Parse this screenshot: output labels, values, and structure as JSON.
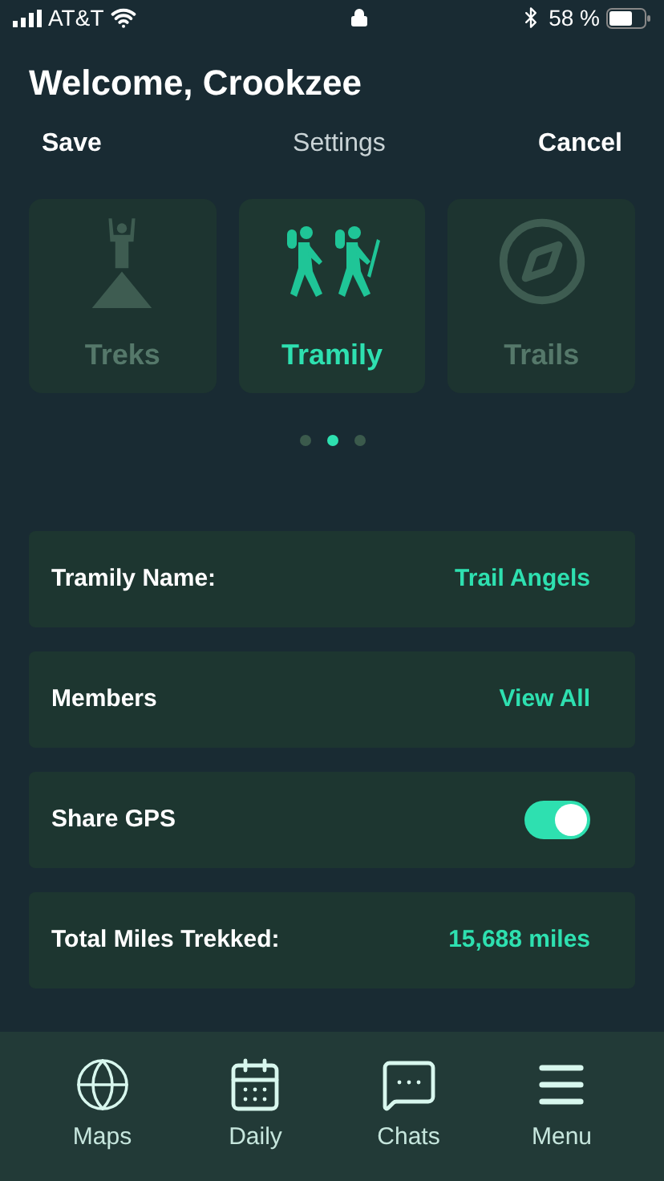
{
  "status_bar": {
    "carrier": "AT&T",
    "battery": "58 %"
  },
  "title": "Welcome, Crookzee",
  "nav": {
    "left": "Save",
    "center": "Settings",
    "right": "Cancel"
  },
  "carousel": [
    {
      "kind": "summit",
      "label": "Treks",
      "selected": false
    },
    {
      "kind": "hikers",
      "label": "Tramily",
      "selected": true
    },
    {
      "kind": "compass",
      "label": "Trails",
      "selected": false
    }
  ],
  "page_dots": [
    {
      "selected": false
    },
    {
      "selected": true
    },
    {
      "selected": false
    }
  ],
  "rows": [
    {
      "kind": "value",
      "label": "Tramily Name:",
      "value": "Trail Angels"
    },
    {
      "kind": "link",
      "label": "Members",
      "value": "View All"
    },
    {
      "kind": "toggle",
      "label": "Share GPS",
      "on": true
    },
    {
      "kind": "value",
      "label": "Total Miles Trekked:",
      "value": "15,688 miles"
    }
  ],
  "tab_bar": [
    {
      "kind": "maps",
      "label": "Maps"
    },
    {
      "kind": "daily",
      "label": "Daily"
    },
    {
      "kind": "chats",
      "label": "Chats"
    },
    {
      "kind": "menu",
      "label": "Menu"
    }
  ]
}
